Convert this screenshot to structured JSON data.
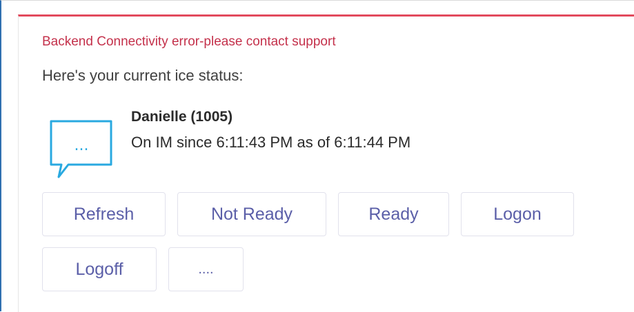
{
  "card": {
    "error_message": "Backend Connectivity error-please contact support",
    "intro_text": "Here's your current ice status:",
    "accent_color": "#c4314b"
  },
  "agent": {
    "name": "Danielle (1005)",
    "status_line": "On IM since 6:11:43 PM as of 6:11:44 PM",
    "status_icon": "chat-bubble-icon",
    "icon_color": "#29a9e0",
    "icon_glyph": "..."
  },
  "actions": {
    "refresh_label": "Refresh",
    "not_ready_label": "Not Ready",
    "ready_label": "Ready",
    "logon_label": "Logon",
    "logoff_label": "Logoff",
    "more_label": "...."
  },
  "theme": {
    "button_text_color": "#5b5fa8",
    "window_border_color": "#2f6fb0"
  }
}
